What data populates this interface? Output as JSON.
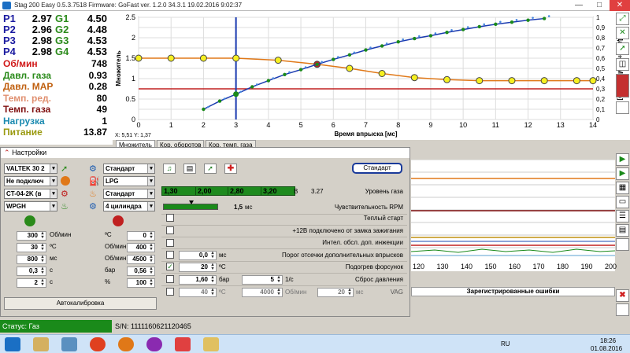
{
  "titlebar": {
    "title": "Stag 200 Easy 0.5.3.7518 Firmware: GoFast  ver. 1.2.0  34.3.1   19.02.2016 9:02:37",
    "minimize": "—",
    "maximize": "□",
    "close": "✕"
  },
  "pressures": [
    {
      "p": "P1",
      "p_val": "2.97",
      "g": "G1",
      "g_val": "4.50"
    },
    {
      "p": "P2",
      "p_val": "2.96",
      "g": "G2",
      "g_val": "4.48"
    },
    {
      "p": "P3",
      "p_val": "2.98",
      "g": "G3",
      "g_val": "4.53"
    },
    {
      "p": "P4",
      "p_val": "2.98",
      "g": "G4",
      "g_val": "4.53"
    }
  ],
  "stats": [
    {
      "label": "Об/мин",
      "value": "748",
      "color": "#d01818"
    },
    {
      "label": "Давл. газа",
      "value": "0.93",
      "color": "#2a8a1a"
    },
    {
      "label": "Давл. MAP",
      "value": "0.28",
      "color": "#c06010"
    },
    {
      "label": "Темп. ред.",
      "value": "80",
      "color": "#e09070"
    },
    {
      "label": "Темп. газа",
      "value": "49",
      "color": "#801010"
    },
    {
      "label": "Нагрузка",
      "value": "1",
      "color": "#1a8ab0"
    },
    {
      "label": "Питание",
      "value": "13.87",
      "color": "#9a9a10"
    }
  ],
  "chart": {
    "ylabel_left": "Множитель",
    "ylabel_right": "Давление MAP [Бар]",
    "xlabel": "Время впрыска [мс]",
    "cursor": "X: 5,51   Y: 1,37",
    "x_ticks": [
      "0",
      "1",
      "2",
      "3",
      "4",
      "5",
      "6",
      "7",
      "8",
      "9",
      "10",
      "11",
      "12",
      "13",
      "14"
    ],
    "y_left_ticks": [
      "0",
      "0.5",
      "1",
      "1.5",
      "2",
      "2.5"
    ],
    "y_right_ticks": [
      "0",
      "0,1",
      "0,2",
      "0,3",
      "0,4",
      "0,5",
      "0,6",
      "0,7",
      "0,8",
      "0,9",
      "1"
    ]
  },
  "chart_data": {
    "type": "scatter",
    "xlabel": "Время впрыска [мс]",
    "ylabel": "Множитель",
    "xlim": [
      0,
      14
    ],
    "ylim": [
      0,
      2.5
    ],
    "series": [
      {
        "name": "Множитель",
        "x": [
          2,
          2.5,
          3,
          3.5,
          4,
          4.5,
          5,
          5.5,
          6,
          6.5,
          7,
          7.5,
          8,
          8.5,
          9,
          9.5,
          10,
          10.5,
          11,
          11.5,
          12,
          12.5
        ],
        "y": [
          0.25,
          0.45,
          0.62,
          0.8,
          0.95,
          1.1,
          1.22,
          1.35,
          1.47,
          1.58,
          1.7,
          1.8,
          1.9,
          1.98,
          2.05,
          2.13,
          2.2,
          2.27,
          2.33,
          2.38,
          2.43,
          2.47
        ]
      },
      {
        "name": "Давление MAP",
        "x": [
          0,
          1,
          2,
          3,
          4.3,
          5.5,
          6.5,
          7.5,
          8.5,
          9.5,
          10.5,
          11.5,
          12.5,
          13.5,
          14
        ],
        "y": [
          0.6,
          0.6,
          0.6,
          0.6,
          0.58,
          0.54,
          0.5,
          0.45,
          0.41,
          0.39,
          0.38,
          0.38,
          0.38,
          0.38,
          0.38
        ]
      }
    ]
  },
  "tabs": [
    "Множитель",
    "Кор. оборотов",
    "Кор. темп. газа"
  ],
  "settings": {
    "header": "Настройки",
    "ecu": "VALTEK 30 2",
    "injection": "Не подключ",
    "reducer": "CT-04-2K (в",
    "sensor": "WPGH",
    "mode": "Стандарт",
    "fuel": "LPG",
    "mode2": "Стандарт",
    "cylinders": "4 цилиндра",
    "standard_btn": "Стандарт",
    "gas_levels": [
      "1,30",
      "2,00",
      "2,80",
      "3,20"
    ],
    "gas_level_unit": "В",
    "gas_level_value": "3.27",
    "gas_level_label": "Уровень газа",
    "rpm_sens_value": "1,5",
    "rpm_sens_unit": "мс",
    "rpm_sens_label": "Чувствительность RPM",
    "opt_warm": "Теплый старт",
    "opt_12v": "+12В подключено от замка зажигания",
    "opt_intel": "Интел. обсл. доп. инжекции",
    "opt_cutoff_val": "0,0",
    "opt_cutoff_unit": "мс",
    "opt_cutoff": "Порог отсечки дополнительных впрысков",
    "opt_heat_val": "20",
    "opt_heat_unit": "ºC",
    "opt_heat": "Подогрев форсунок",
    "opt_press1": "1,60",
    "opt_press1_unit": "бар",
    "opt_press2": "5",
    "opt_press2_unit": "1/с",
    "opt_press": "Сброс давления",
    "vag_1": "40",
    "vag_1_unit": "ºC",
    "vag_2": "4000",
    "vag_2_unit": "Об/мин",
    "vag_3": "20",
    "vag_3_unit": "мс",
    "vag": "VAG",
    "left_params": [
      {
        "a": "300",
        "ua": "Об/мин",
        "b": "0",
        "ub": "ºC"
      },
      {
        "a": "30",
        "ua": "ºC",
        "b": "400",
        "ub": "Об/мин"
      },
      {
        "a": "800",
        "ua": "мс",
        "b": "4500",
        "ub": "Об/мин"
      },
      {
        "a": "0,3",
        "ua": "с",
        "b": "0,56",
        "ub": "бар"
      },
      {
        "a": "2",
        "ua": "с",
        "b": "100",
        "ub": "%"
      }
    ],
    "autocal": "Автокалибровка"
  },
  "osc_ticks": [
    "120",
    "130",
    "140",
    "150",
    "160",
    "170",
    "180",
    "190",
    "200"
  ],
  "errors_header": "Зарегистрированные ошибки",
  "status": {
    "gas": "Статус: Газ",
    "serial": "S/N: 1111160621120465"
  },
  "taskbar": {
    "lang": "RU",
    "time": "18:26",
    "date": "01.08.2016"
  }
}
